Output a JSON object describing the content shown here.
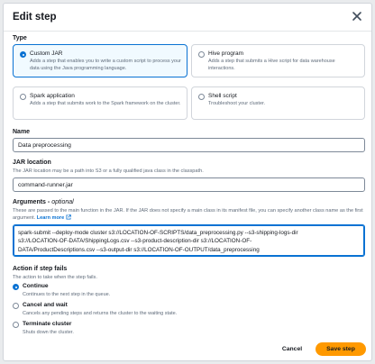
{
  "modal": {
    "title": "Edit step"
  },
  "type_section": {
    "label": "Type",
    "options": [
      {
        "title": "Custom JAR",
        "desc": "Adds a step that enables you to write a custom script to process your data using the Java programming language.",
        "selected": true
      },
      {
        "title": "Hive program",
        "desc": "Adds a step that submits a Hive script for data warehouse interactions.",
        "selected": false
      },
      {
        "title": "Spark application",
        "desc": "Adds a step that submits work to the Spark framework on the cluster.",
        "selected": false
      },
      {
        "title": "Shell script",
        "desc": "Troubleshoot your cluster.",
        "selected": false
      }
    ]
  },
  "name_field": {
    "label": "Name",
    "value": "Data preprocessing"
  },
  "jar_field": {
    "label": "JAR location",
    "desc": "The JAR location may be a path into S3 or a fully qualified java class in the classpath.",
    "value": "command-runner.jar"
  },
  "arguments_field": {
    "label": "Arguments",
    "label_suffix": "optional",
    "desc": "These are passed to the main function in the JAR. If the JAR does not specify a main class in its manifest file, you can specify another class name as the first argument.",
    "learn_more": "Learn more",
    "lines": [
      "spark-submit --deploy-mode cluster s3://LOCATION-OF-SCRIPTS/data_preprocessing.py --s3-shipping-logs-dir",
      "s3://LOCATION-OF-DATA/ShippingLogs.csv --s3-product-description-dir s3://LOCATION-OF-",
      "DATA/ProductDescriptions.csv --s3-output-dir s3://LOCATION-OF-OUTPUT/data_preprocessing"
    ]
  },
  "action_section": {
    "label": "Action if step fails",
    "desc": "The action to take when the step fails.",
    "options": [
      {
        "title": "Continue",
        "desc": "Continues to the next step in the queue.",
        "selected": true
      },
      {
        "title": "Cancel and wait",
        "desc": "Cancels any pending steps and returns the cluster to the waiting state.",
        "selected": false
      },
      {
        "title": "Terminate cluster",
        "desc": "Shuts down the cluster.",
        "selected": false
      }
    ]
  },
  "footer": {
    "cancel_label": "Cancel",
    "save_label": "Save step"
  },
  "colors": {
    "accent": "#0972d3",
    "primary_button": "#ff9900"
  },
  "icons": {
    "close": "close-icon",
    "external": "external-link-icon"
  }
}
